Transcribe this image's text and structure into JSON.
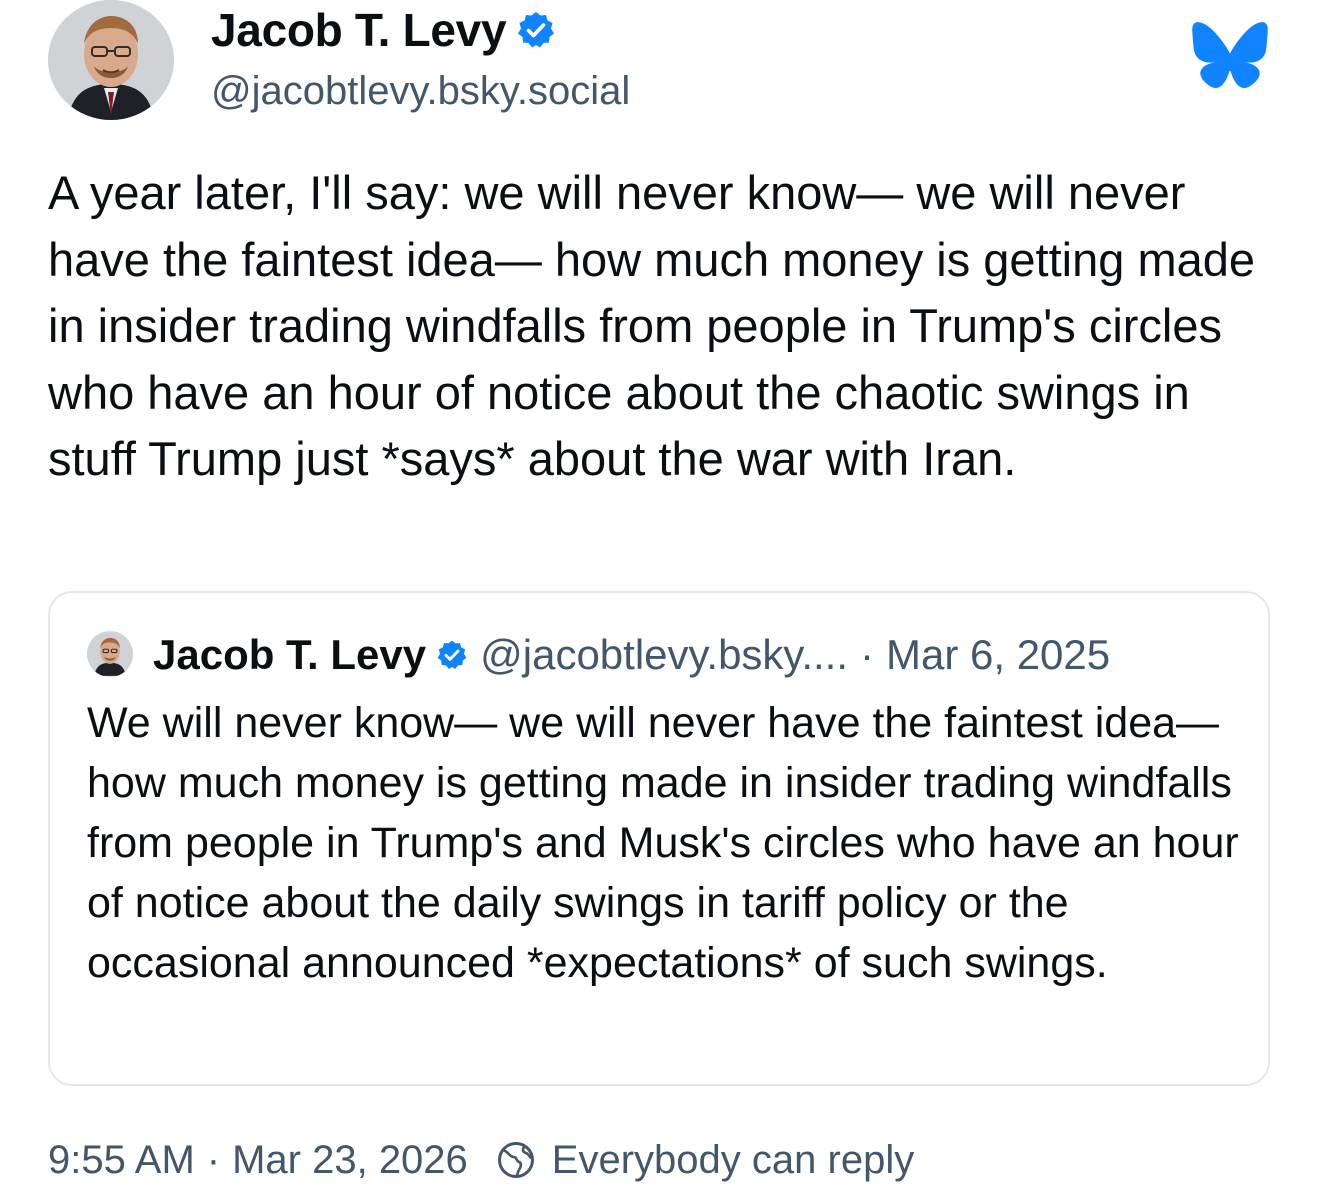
{
  "post": {
    "author": {
      "name": "Jacob T. Levy",
      "handle": "@jacobtlevy.bsky.social",
      "avatar": "author-photo",
      "verified_icon": "verified-check-icon"
    },
    "app_icon": "bluesky-butterfly-icon",
    "text": "A year later, I'll say: we will never know— we will never have the faintest idea— how much money is getting made in insider trading windfalls from people in Trump's circles who have an hour of notice about the chaotic swings in stuff Trump just *says* about the war with Iran.",
    "quote": {
      "author_name": "Jacob T. Levy",
      "handle": "@jacobtlevy.bsky....",
      "separator": "·",
      "date": "Mar 6, 2025",
      "text": "We will never know— we will never have the faintest idea— how much money is getting made in insider trading windfalls from people in Trump's and Musk's circles who have an hour of notice about the daily swings in tariff policy or the occasional announced *expectations* of such swings."
    },
    "footer": {
      "time": "9:55 AM",
      "separator": "·",
      "date": "Mar 23, 2026",
      "reply_icon": "globe-reply-icon",
      "reply_setting": "Everybody can reply"
    }
  },
  "colors": {
    "accent": "#1083fe",
    "text": "#0b0f14",
    "muted": "#42576c",
    "border": "#e4e8ec"
  }
}
